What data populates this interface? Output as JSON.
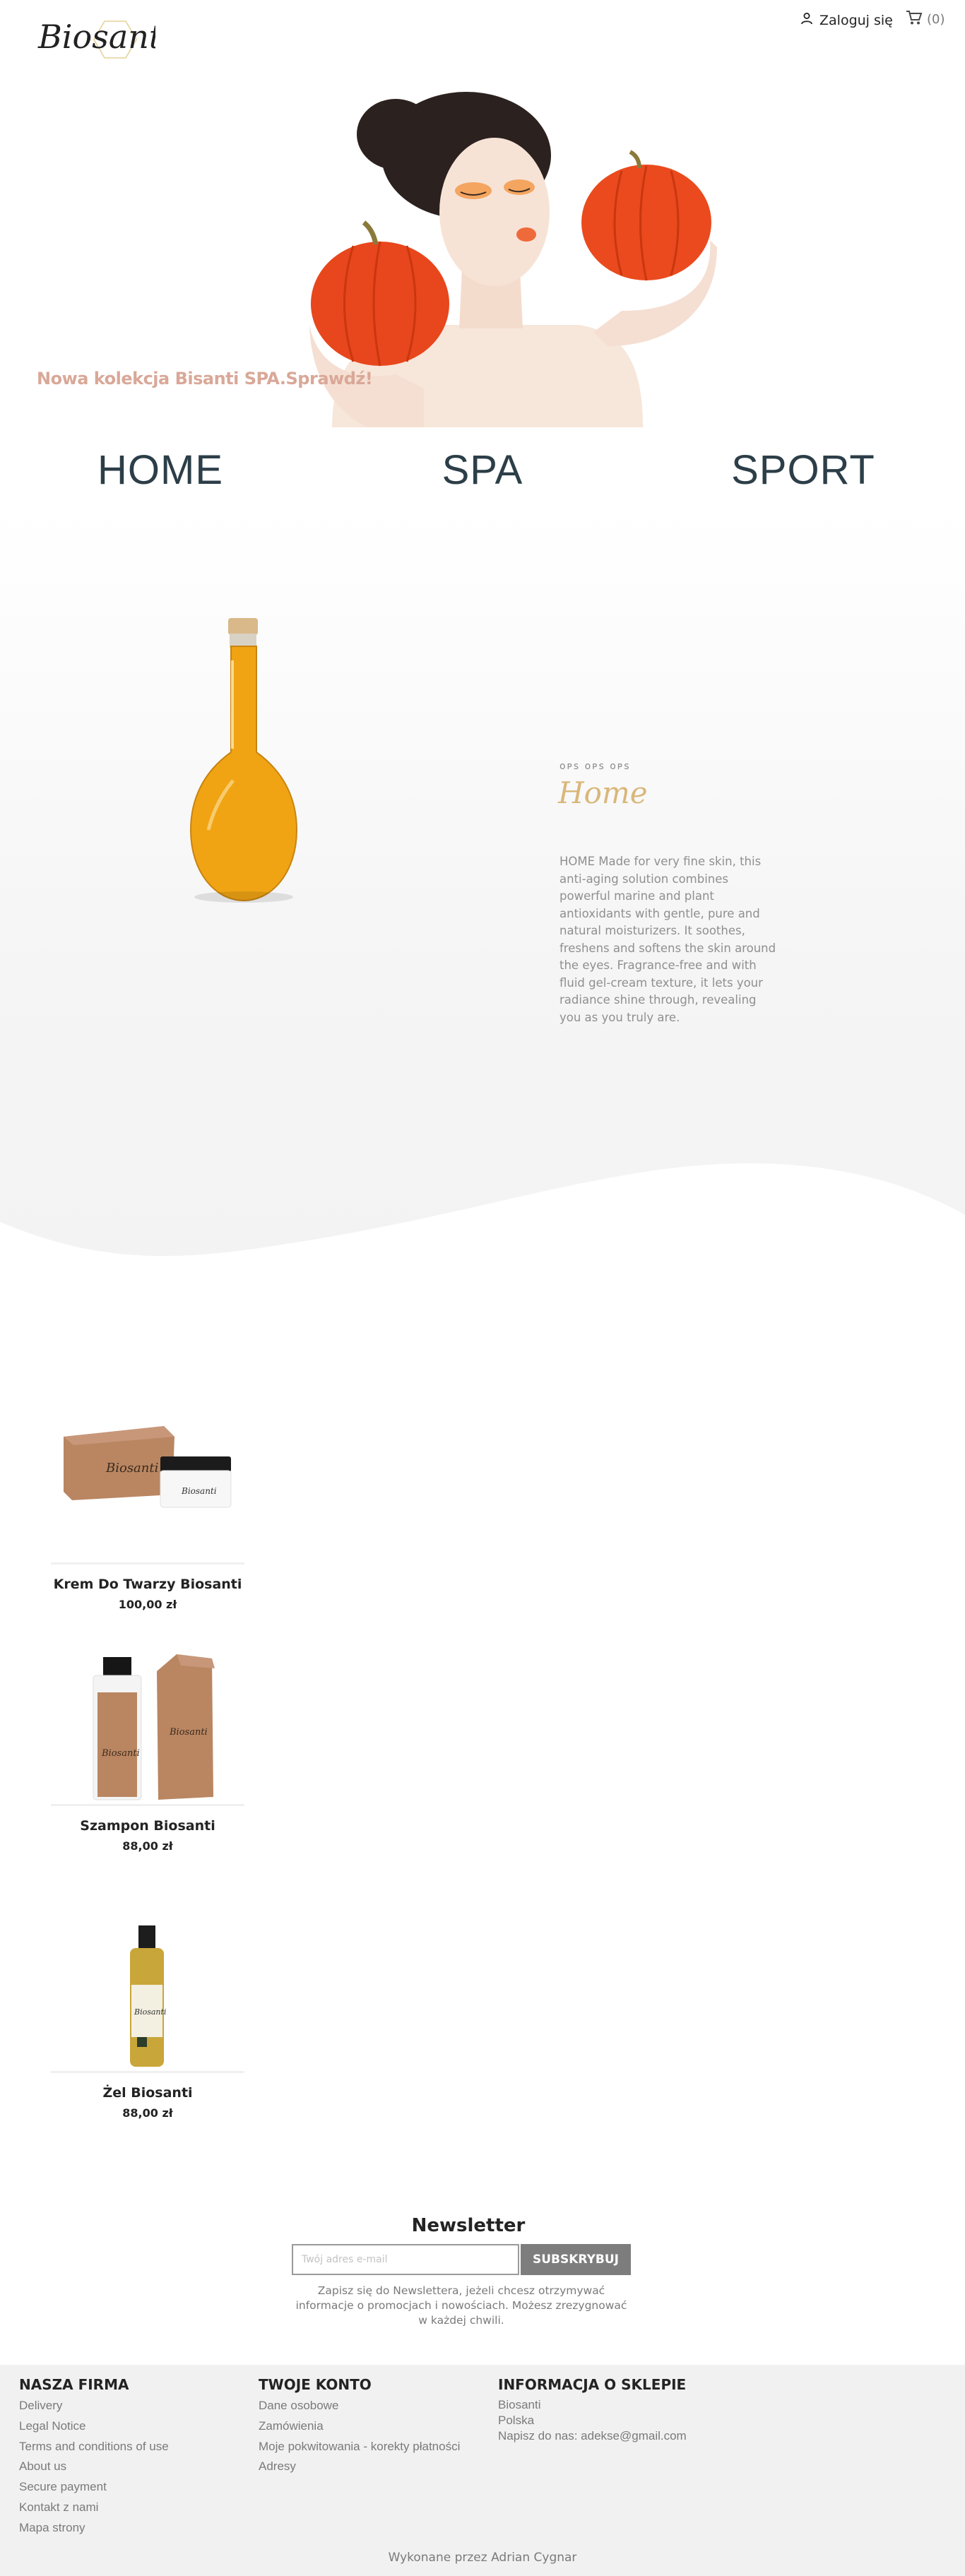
{
  "header": {
    "logo_text": "Biosanti",
    "login_label": "Zaloguj się",
    "cart_count": "(0)"
  },
  "hero": {
    "tagline": "Nowa kolekcja Bisanti SPA.Sprawdź!"
  },
  "nav": {
    "items": [
      {
        "label": "HOME"
      },
      {
        "label": "SPA"
      },
      {
        "label": "SPORT"
      }
    ]
  },
  "feature": {
    "small_caps": "ᴏᴩs ᴏᴩs ᴏᴩs",
    "title": "Home",
    "description": "HOME Made for very fine skin, this anti-aging solution combines powerful marine and plant antioxidants with gentle, pure and natural moisturizers. It soothes, freshens and softens the skin around the eyes. Fragrance-free and with fluid gel-cream texture, it lets your radiance shine through, revealing you as you truly are."
  },
  "products": [
    {
      "name": "Krem Do Twarzy Biosanti",
      "price": "100,00 zł"
    },
    {
      "name": "Szampon Biosanti",
      "price": "88,00 zł"
    },
    {
      "name": "Żel Biosanti",
      "price": "88,00 zł"
    }
  ],
  "newsletter": {
    "title": "Newsletter",
    "placeholder": "Twój adres e-mail",
    "button": "SUBSKRYBUJ",
    "note": "Zapisz się do Newslettera, jeżeli chcesz otrzymywać informacje o promocjach i nowościach. Możesz zrezygnować w każdej chwili."
  },
  "footer": {
    "col1": {
      "title": "NASZA FIRMA",
      "links": [
        "Delivery",
        "Legal Notice",
        "Terms and conditions of use",
        "About us",
        "Secure payment",
        "Kontakt z nami",
        "Mapa strony"
      ]
    },
    "col2": {
      "title": "TWOJE KONTO",
      "links": [
        "Dane osobowe",
        "Zamówienia",
        "Moje pokwitowania - korekty płatności",
        "Adresy"
      ]
    },
    "col3": {
      "title": "INFORMACJA O SKLEPIE",
      "lines": [
        "Biosanti",
        "Polska",
        "Napisz do nas: adekse@gmail.com"
      ]
    },
    "credit": "Wykonane przez Adrian Cygnar"
  },
  "colors": {
    "hero_text": "#d9a898",
    "nav_text": "#2c3e48",
    "feature_title": "#d9b77a",
    "button_bg": "#7d7d7d",
    "footer_bg": "#f1f1f1"
  }
}
